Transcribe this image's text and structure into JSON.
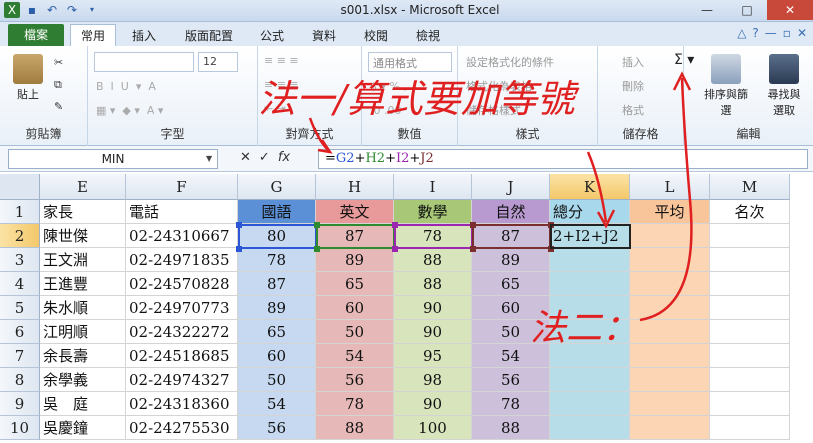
{
  "window": {
    "title": "s001.xlsx - Microsoft Excel",
    "minimize": "—",
    "maximize": "□",
    "close": "✕"
  },
  "tabs": {
    "file": "檔案",
    "items": [
      "常用",
      "插入",
      "版面配置",
      "公式",
      "資料",
      "校閱",
      "檢視"
    ],
    "active": "常用"
  },
  "ribbon": {
    "clipboard": {
      "label": "剪貼簿",
      "paste": "貼上"
    },
    "font": {
      "label": "字型",
      "size": "12"
    },
    "alignment": {
      "label": "對齊方式"
    },
    "number": {
      "label": "數值",
      "format": "通用格式"
    },
    "styles": {
      "label": "樣式",
      "conditional": "設定格式化的條件",
      "table": "格式化為表格",
      "cell": "儲存格樣式"
    },
    "cells": {
      "label": "儲存格",
      "insert": "插入",
      "delete": "刪除",
      "format": "格式"
    },
    "editing": {
      "label": "編輯",
      "sort": "排序與篩選",
      "find": "尋找與選取"
    }
  },
  "formula_bar": {
    "name_box": "MIN",
    "cancel": "✕",
    "enter": "✓",
    "fx": "fx",
    "formula_parts": [
      {
        "text": "=",
        "color": "#000000"
      },
      {
        "text": "G2",
        "color": "#2b57d6"
      },
      {
        "text": "+",
        "color": "#000000"
      },
      {
        "text": "H2",
        "color": "#2e8a2e"
      },
      {
        "text": "+",
        "color": "#000000"
      },
      {
        "text": "I2",
        "color": "#9b27b0"
      },
      {
        "text": "+",
        "color": "#000000"
      },
      {
        "text": "J2",
        "color": "#7a2e2e"
      }
    ]
  },
  "sheet": {
    "columns": [
      "E",
      "F",
      "G",
      "H",
      "I",
      "J",
      "K",
      "L",
      "M"
    ],
    "selected_column": "K",
    "selected_row": "2",
    "header_row": [
      "家長",
      "電話",
      "國語",
      "英文",
      "數學",
      "自然",
      "總分",
      "平均",
      "名次"
    ],
    "header_colors": [
      "#ffffff",
      "#ffffff",
      "#5b8fd6",
      "#e89a9a",
      "#a8c878",
      "#b89ad0",
      "#a8d8ec",
      "#f8c49a",
      "#ffffff"
    ],
    "column_fills": [
      "#ffffff",
      "#ffffff",
      "#c6d9f0",
      "#e6b9b8",
      "#d7e4bc",
      "#ccc0da",
      "#b7dee8",
      "#fcd5b4",
      "#ffffff"
    ],
    "rows": [
      {
        "num": "2",
        "cells": [
          "陳世傑",
          "02-24310667",
          "80",
          "87",
          "78",
          "87",
          "2+I2+J2",
          "",
          ""
        ]
      },
      {
        "num": "3",
        "cells": [
          "王文淵",
          "02-24971835",
          "78",
          "89",
          "88",
          "89",
          "",
          "",
          ""
        ]
      },
      {
        "num": "4",
        "cells": [
          "王進豐",
          "02-24570828",
          "87",
          "65",
          "88",
          "65",
          "",
          "",
          ""
        ]
      },
      {
        "num": "5",
        "cells": [
          "朱水順",
          "02-24970773",
          "89",
          "60",
          "90",
          "60",
          "",
          "",
          ""
        ]
      },
      {
        "num": "6",
        "cells": [
          "江明順",
          "02-24322272",
          "65",
          "50",
          "90",
          "50",
          "",
          "",
          ""
        ]
      },
      {
        "num": "7",
        "cells": [
          "余長壽",
          "02-24518685",
          "60",
          "54",
          "95",
          "54",
          "",
          "",
          ""
        ]
      },
      {
        "num": "8",
        "cells": [
          "余學義",
          "02-24974327",
          "50",
          "56",
          "98",
          "56",
          "",
          "",
          ""
        ]
      },
      {
        "num": "9",
        "cells": [
          "吳　庭",
          "02-24318360",
          "54",
          "78",
          "90",
          "78",
          "",
          "",
          ""
        ]
      },
      {
        "num": "10",
        "cells": [
          "吳慶鐘",
          "02-24275530",
          "56",
          "88",
          "100",
          "88",
          "",
          "",
          ""
        ]
      }
    ]
  },
  "annotations": {
    "method1": "法一/算式要加等號",
    "method2": "法二："
  }
}
